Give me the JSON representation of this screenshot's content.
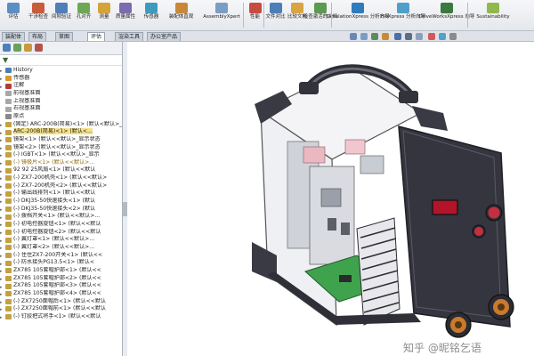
{
  "ribbon": {
    "buttons": [
      {
        "label": "评估"
      },
      {
        "label": "干涉检查"
      },
      {
        "label": "间隙验证"
      },
      {
        "label": "孔对齐"
      },
      {
        "label": "测量"
      },
      {
        "label": "质量属性"
      },
      {
        "label": "传感器"
      },
      {
        "label": "装配体直观"
      },
      {
        "label": "AssemblyXpert"
      },
      {
        "label": "性能"
      },
      {
        "label": "文件对比"
      },
      {
        "label": "比较文档"
      },
      {
        "label": "检查激活的文档"
      },
      {
        "label": "SimulationXpress 分析向导"
      },
      {
        "label": "FloXpress 分析向导"
      },
      {
        "label": "DriveWorksXpress 向导"
      },
      {
        "label": "Sustainability"
      }
    ]
  },
  "tabs": [
    "装配体",
    "布局",
    "草图",
    "评估",
    "渲染工具",
    "办公室产品"
  ],
  "active_tab": "评估",
  "tree": {
    "items": [
      {
        "label": "History",
        "kind": "folder"
      },
      {
        "label": "传感器",
        "kind": "sensor"
      },
      {
        "label": "注解",
        "kind": "note"
      },
      {
        "label": "前视基准面",
        "kind": "plane"
      },
      {
        "label": "上视基准面",
        "kind": "plane"
      },
      {
        "label": "右视基准面",
        "kind": "plane"
      },
      {
        "label": "原点",
        "kind": "origin"
      },
      {
        "label": "(固定) ARC-200B(简易)<1> (默认<默认>_显示状态1>",
        "kind": "part"
      },
      {
        "label": "ARC-200B(简易)<1> (默认<...",
        "kind": "part",
        "selected": true
      },
      {
        "label": "镜架<1> (默认<<默认>_显示状态",
        "kind": "part"
      },
      {
        "label": "镜架<2> (默认<<默认>_显示状态",
        "kind": "part"
      },
      {
        "label": "(-) IGBT<1> (默认<<默认>_显示",
        "kind": "part"
      },
      {
        "label": "(-) 镜极片<1> (默认<<默认>...",
        "kind": "part",
        "warn": true
      },
      {
        "label": "92 92 25风扇<1> (默认<<默认",
        "kind": "part"
      },
      {
        "label": "(-) ZX7-200机壳<1> (默认<<默认>",
        "kind": "part"
      },
      {
        "label": "(-) ZX7-200机壳<2> (默认<<默认>",
        "kind": "part"
      },
      {
        "label": "(-) 输出线排列<1> (默认<<默认",
        "kind": "part"
      },
      {
        "label": "(-) DKJ35-50快速接头<1> (默认",
        "kind": "part"
      },
      {
        "label": "(-) DKJ35-50快速接头<2> (默认",
        "kind": "part"
      },
      {
        "label": "(-) 拨档开关<1> (默认<<默认>...",
        "kind": "part"
      },
      {
        "label": "(-) 初电控器旋钮<1> (默认<<默认",
        "kind": "part"
      },
      {
        "label": "(-) 初电控器旋钮<2> (默认<<默认",
        "kind": "part"
      },
      {
        "label": "(-) 翼灯罩<1> (默认<<默认>...",
        "kind": "part"
      },
      {
        "label": "(-) 翼灯罩<2> (默认<<默认>...",
        "kind": "part"
      },
      {
        "label": "(-) 住住ZX7-200开关<1> (默认<<",
        "kind": "part"
      },
      {
        "label": "(-) 防水接头PG13.5<1> (默认<",
        "kind": "part"
      },
      {
        "label": "ZX785 105套帽护部<1> (默认<<",
        "kind": "part"
      },
      {
        "label": "ZX785 105套帽护部<2> (默认<<",
        "kind": "part"
      },
      {
        "label": "ZX785 105套帽护部<3> (默认<<",
        "kind": "part"
      },
      {
        "label": "ZX785 105套帽护部<4> (默认<<",
        "kind": "part"
      },
      {
        "label": "(-) ZX7250面帽后<1> (默认<<默认",
        "kind": "part"
      },
      {
        "label": "(-) ZX7250面帽前<1> (默认<<默认",
        "kind": "part"
      },
      {
        "label": "(-) 钉胶把式将手<1> (默认<<默认",
        "kind": "part"
      }
    ]
  },
  "watermark": "知乎 @昵铭乞语",
  "colors": {
    "ribbon_bg": "#e8ebef",
    "selection": "#f5e28a",
    "housing_dark": "#3a3a44",
    "panel_red": "#b3142a",
    "pcb_green": "#3fa34d"
  }
}
